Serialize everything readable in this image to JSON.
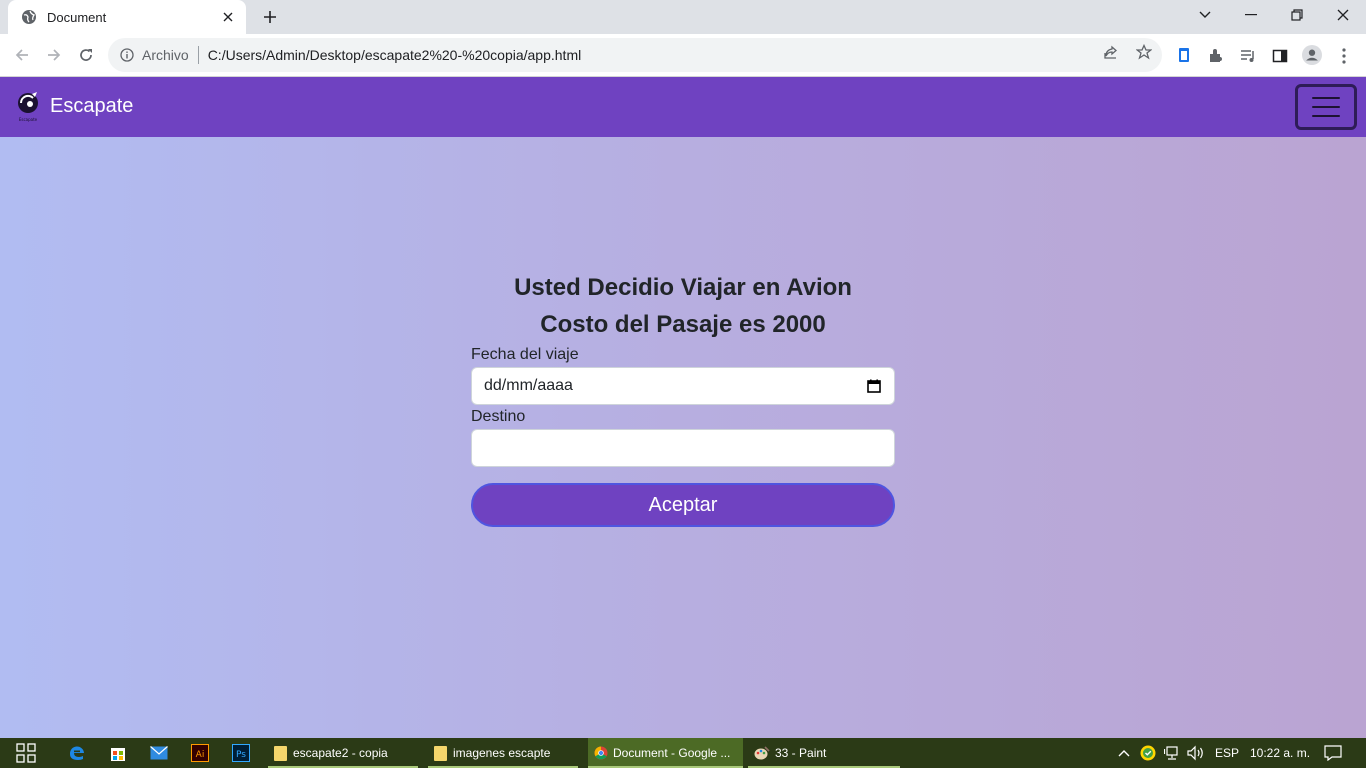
{
  "browser": {
    "tab_title": "Document",
    "address_scheme": "Archivo",
    "address_url": "C:/Users/Admin/Desktop/escapate2%20-%20copia/app.html"
  },
  "navbar": {
    "brand": "Escapate",
    "logo_caption": "Escapate"
  },
  "main": {
    "heading_1": "Usted Decidio Viajar en Avion",
    "heading_2": "Costo del Pasaje es 2000",
    "date_label": "Fecha del viaje",
    "date_placeholder": "dd/mm/aaaa",
    "destination_label": "Destino",
    "destination_value": "",
    "accept_button": "Aceptar"
  },
  "taskbar": {
    "apps": [
      {
        "label": "escapate2 - copia",
        "icon": "folder-icon"
      },
      {
        "label": "imagenes escapte",
        "icon": "folder-icon"
      },
      {
        "label": "Document - Google ...",
        "icon": "chrome-icon"
      },
      {
        "label": "33 - Paint",
        "icon": "paint-icon"
      }
    ],
    "language": "ESP",
    "clock": "10:22 a. m."
  },
  "colors": {
    "navbar": "#6f42c1",
    "button": "#6f42c1",
    "button_border": "#4f55e0",
    "page_gradient_start": "#b1bcf2",
    "page_gradient_end": "#baa4d2"
  }
}
